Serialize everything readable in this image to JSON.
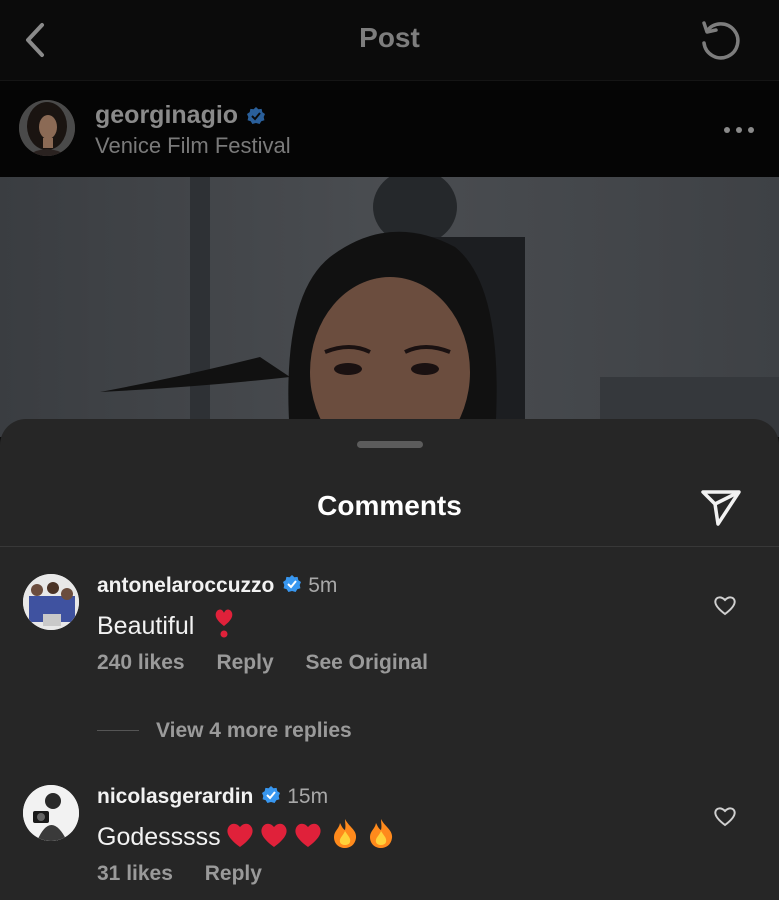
{
  "header": {
    "title": "Post"
  },
  "post": {
    "username": "georginagio",
    "location": "Venice Film Festival"
  },
  "comments_sheet": {
    "title": "Comments"
  },
  "comments": [
    {
      "username": "antonelaroccuzzo",
      "time": "5m",
      "text": "Beautiful",
      "likes": "240 likes",
      "reply": "Reply",
      "see_original": "See Original"
    },
    {
      "username": "nicolasgerardin",
      "time": "15m",
      "text": "Godesssss",
      "likes": "31 likes",
      "reply": "Reply"
    }
  ],
  "view_replies": "View 4 more replies",
  "colors": {
    "verified": "#3897f0",
    "sheet_bg": "#262626",
    "heart_emoji": "#e0213a",
    "fire_emoji": "#ff8a1c"
  }
}
